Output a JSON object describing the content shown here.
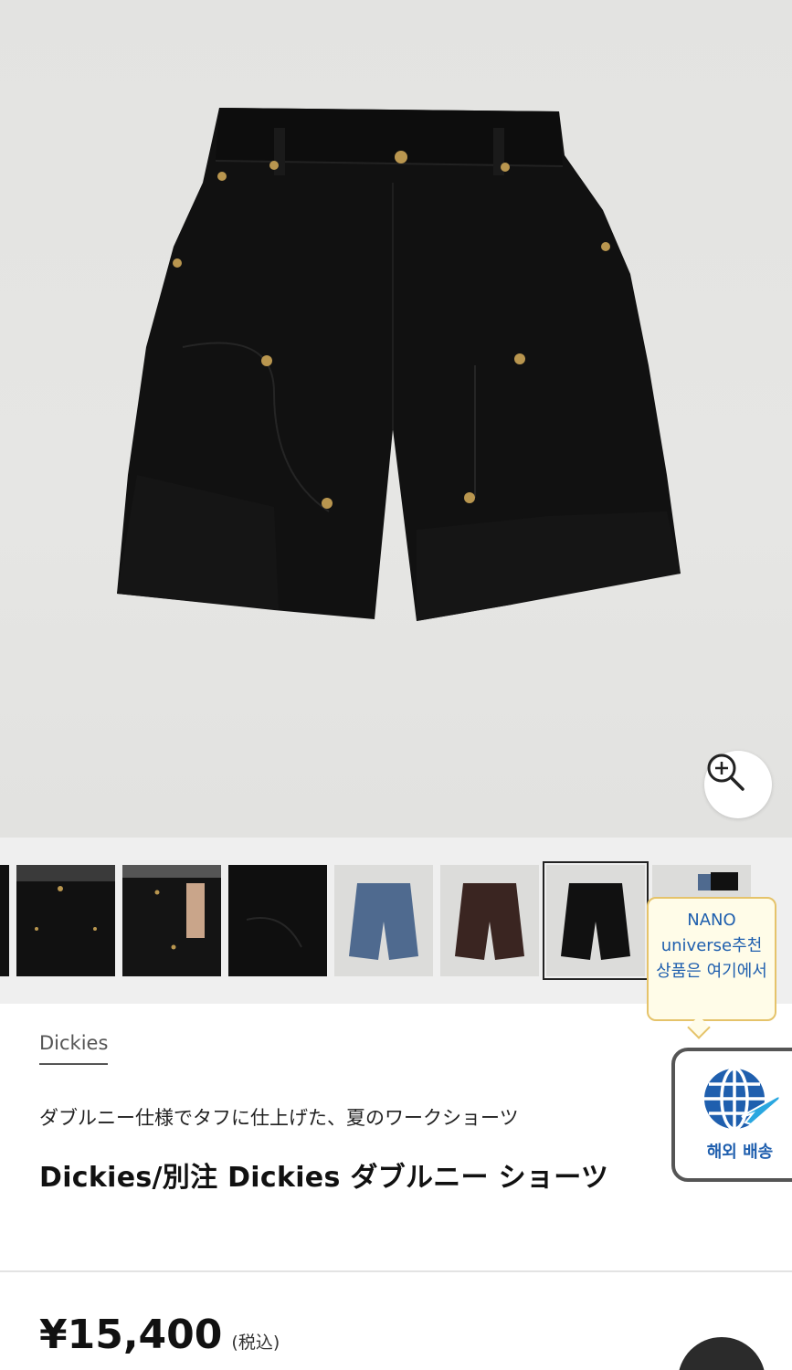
{
  "zoom": {
    "icon": "zoom-in-icon"
  },
  "thumbnails": [
    {
      "name": "thumb-edge-partial",
      "desc": "model-side"
    },
    {
      "name": "thumb-model-front",
      "desc": "model-front"
    },
    {
      "name": "thumb-model-pocket",
      "desc": "model-pocket"
    },
    {
      "name": "thumb-fabric-closeup",
      "desc": "fabric-closeup"
    },
    {
      "name": "thumb-blue",
      "desc": "blue-shorts"
    },
    {
      "name": "thumb-brown",
      "desc": "brown-shorts"
    },
    {
      "name": "thumb-black",
      "desc": "black-shorts",
      "selected": true
    },
    {
      "name": "thumb-set",
      "desc": "color-set"
    }
  ],
  "tooltip": {
    "text": "NANO universe추천 상품은 여기에서"
  },
  "shipping": {
    "label": "해외 배송",
    "icon": "globe-plane-icon",
    "color": "#1f5fae"
  },
  "product": {
    "brand": "Dickies",
    "subtitle": "ダブルニー仕様でタフに仕上げた、夏のワークショーツ",
    "title": "Dickies/別注 Dickies ダブルニー ショーツ",
    "price": "¥15,400",
    "tax_note": "(税込)"
  },
  "colors": {
    "accent": "#1f5fae",
    "tooltip_border": "#e5c36a",
    "tooltip_bg": "#fffce8"
  }
}
